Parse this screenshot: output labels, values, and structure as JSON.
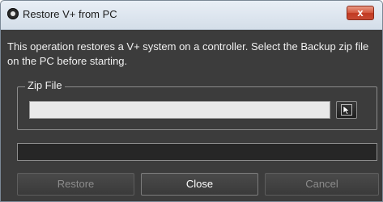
{
  "window": {
    "title": "Restore V+ from PC",
    "close_glyph": "x",
    "icon": "app-logo-icon"
  },
  "description": "This operation restores a V+ system on a controller. Select the Backup zip file on the PC before starting.",
  "zip_file": {
    "group_label": "Zip File",
    "value": "",
    "placeholder": "",
    "browse_icon": "browse-cursor-icon"
  },
  "progress": {
    "value": 0
  },
  "buttons": {
    "restore": "Restore",
    "close": "Close",
    "cancel": "Cancel"
  },
  "colors": {
    "background": "#3c3c3c",
    "titlebar": "#dfe7f0",
    "close_button": "#c74a33",
    "text": "#f0f0f0",
    "disabled_text": "#8c8c8c"
  }
}
